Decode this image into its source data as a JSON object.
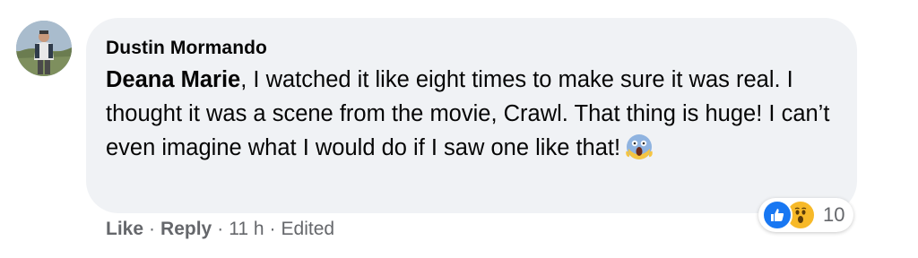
{
  "comment": {
    "author": "Dustin Mormando",
    "mention": "Deana Marie",
    "body": ", I watched it like eight times to make sure it was real. I thought it was a scene from the movie, Crawl. That thing is huge! I can’t even imagine what I would do if I saw one like that!",
    "emoji": "face-screaming-in-fear",
    "reactions": {
      "types": [
        "like",
        "wow"
      ],
      "count": "10"
    },
    "actions": {
      "like": "Like",
      "reply": "Reply",
      "separator": "·",
      "time": "11 h",
      "edited": "Edited"
    }
  },
  "colors": {
    "bubble": "#f0f2f5",
    "text": "#050505",
    "meta": "#65676b",
    "like_blue": "#1877f2",
    "wow_yellow": "#f7b928"
  }
}
